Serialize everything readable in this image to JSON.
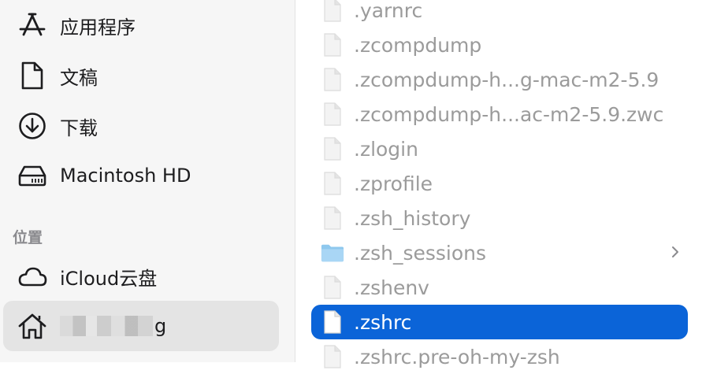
{
  "sidebar": {
    "favorites": [
      {
        "label": "应用程序",
        "icon": "applications-icon"
      },
      {
        "label": "文稿",
        "icon": "document-icon"
      },
      {
        "label": "下载",
        "icon": "download-icon"
      },
      {
        "label": "Macintosh HD",
        "icon": "drive-icon"
      }
    ],
    "section_locations": "位置",
    "locations": [
      {
        "label": "iCloud云盘",
        "icon": "cloud-icon"
      },
      {
        "label": "g",
        "icon": "home-icon"
      }
    ]
  },
  "files": [
    {
      "name": ".yarnrc",
      "type": "file"
    },
    {
      "name": ".zcompdump",
      "type": "file"
    },
    {
      "name": ".zcompdump-h...g-mac-m2-5.9",
      "type": "file"
    },
    {
      "name": ".zcompdump-h...ac-m2-5.9.zwc",
      "type": "file"
    },
    {
      "name": ".zlogin",
      "type": "file"
    },
    {
      "name": ".zprofile",
      "type": "file"
    },
    {
      "name": ".zsh_history",
      "type": "file"
    },
    {
      "name": ".zsh_sessions",
      "type": "folder"
    },
    {
      "name": ".zshenv",
      "type": "file"
    },
    {
      "name": ".zshrc",
      "type": "file",
      "selected": true
    },
    {
      "name": ".zshrc.pre-oh-my-zsh",
      "type": "file"
    }
  ],
  "colors": {
    "selection": "#0b64d8",
    "sidebar_bg": "#f6f6f6",
    "dim_text": "#9b9b9b",
    "folder": "#7fbde8"
  }
}
